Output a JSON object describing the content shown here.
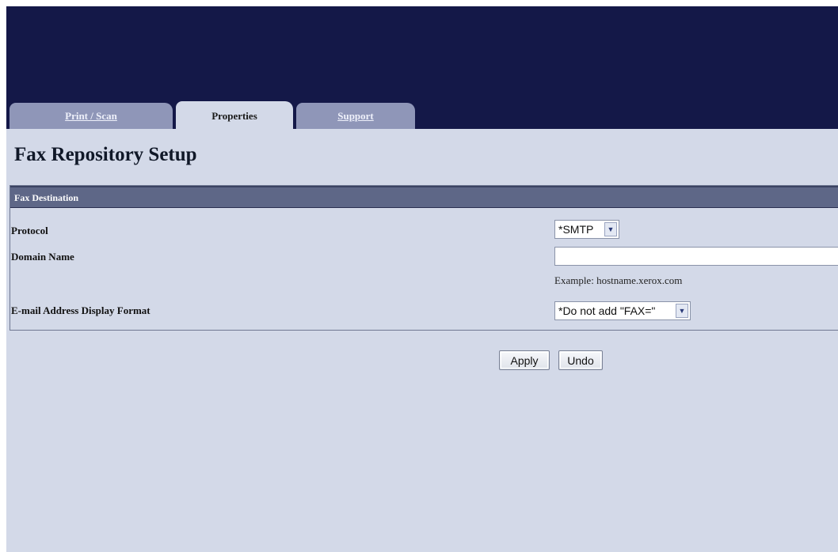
{
  "tabs": [
    {
      "label": "Print / Scan",
      "active": false
    },
    {
      "label": "Properties",
      "active": true
    },
    {
      "label": "Support",
      "active": false
    }
  ],
  "page_title": "Fax Repository Setup",
  "section": {
    "header": "Fax Destination",
    "fields": {
      "protocol": {
        "label": "Protocol",
        "value": "*SMTP"
      },
      "domain_name": {
        "label": "Domain Name",
        "value": "",
        "hint": "Example: hostname.xerox.com"
      },
      "email_format": {
        "label": "E-mail Address Display Format",
        "value": "*Do not add \"FAX=\""
      }
    }
  },
  "buttons": {
    "apply": "Apply",
    "undo": "Undo"
  },
  "colors": {
    "banner": "#141848",
    "page_bg": "#d3d9e8",
    "panel_header": "#5e6787",
    "tab_inactive": "#8f96b8"
  }
}
